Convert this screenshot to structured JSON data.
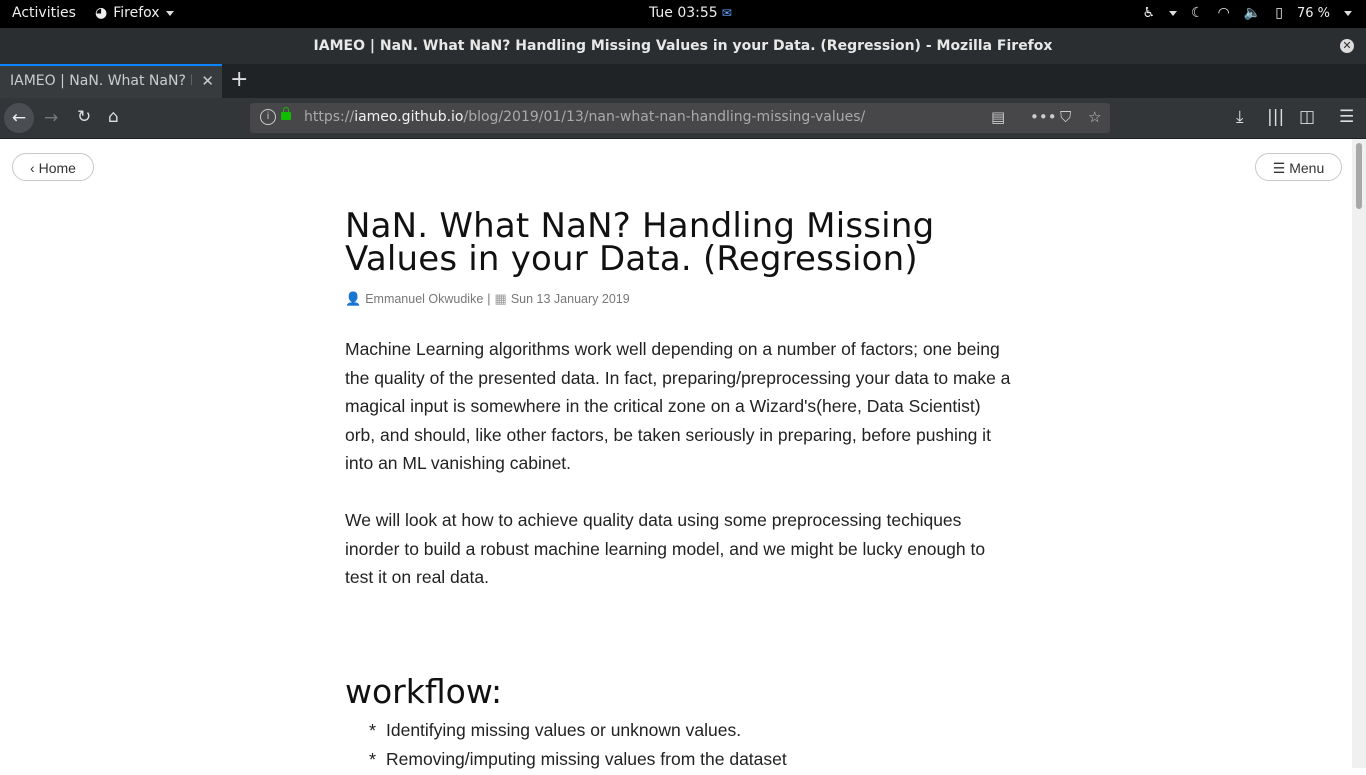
{
  "topbar": {
    "activities": "Activities",
    "app_name": "Firefox",
    "clock": "Tue 03:55",
    "battery_percent": "76 %"
  },
  "window": {
    "title": "IAMEO | NaN. What NaN? Handling Missing Values in your Data. (Regression) - Mozilla Firefox"
  },
  "tabs": [
    {
      "title": "IAMEO | NaN. What NaN? Handling Missing Values in your Data. (Regression)"
    }
  ],
  "urlbar": {
    "scheme": "https://",
    "host": "iameo.github.io",
    "path": "/blog/2019/01/13/nan-what-nan-handling-missing-values/"
  },
  "page": {
    "home_button": "Home",
    "menu_button": "Menu",
    "title": "NaN. What NaN? Handling Missing Values in your Data. (Regression)",
    "author": "Emmanuel Okwudike",
    "separator": "|",
    "date": "Sun 13 January 2019",
    "paragraphs": [
      "Machine Learning algorithms work well depending on a number of factors; one being the quality of the presented data. In fact, preparing/preprocessing your data to make a magical input is somewhere in the critical zone on a Wizard's(here, Data Scientist) orb, and should, like other factors, be taken seriously in preparing, before pushing it into an ML vanishing cabinet.",
      "We will look at how to achieve quality data using some preprocessing techiques inorder to build a robust machine learning model, and we might be lucky enough to test it on real data."
    ],
    "workflow_heading": "workflow:",
    "workflow_items": [
      "Identifying missing values or unknown values.",
      "Removing/imputing missing values from the dataset"
    ]
  }
}
